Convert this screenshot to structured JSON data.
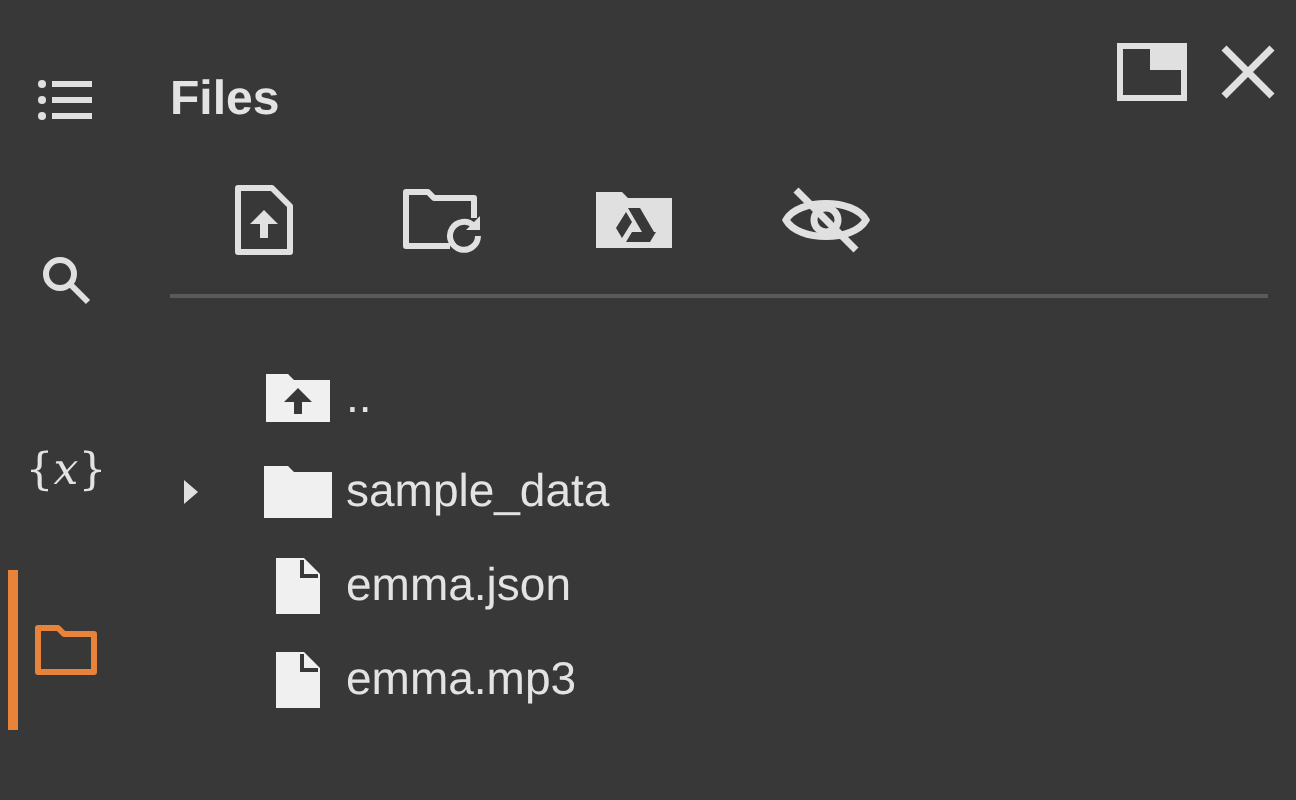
{
  "sidebar": {
    "items": [
      {
        "kind": "menu",
        "selected": false
      },
      {
        "kind": "search",
        "selected": false
      },
      {
        "kind": "variables",
        "label": "{*x*}",
        "selected": false
      },
      {
        "kind": "files",
        "selected": true
      }
    ]
  },
  "panel": {
    "title": "Files"
  },
  "tree": [
    {
      "kind": "parent",
      "label": ".."
    },
    {
      "kind": "folder",
      "label": "sample_data",
      "expanded": false
    },
    {
      "kind": "file",
      "label": "emma.json"
    },
    {
      "kind": "file",
      "label": "emma.mp3"
    }
  ]
}
